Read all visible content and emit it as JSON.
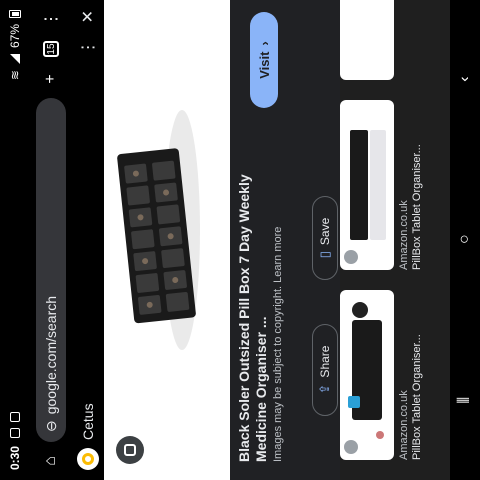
{
  "status_bar": {
    "time": "0:30",
    "battery": "67%"
  },
  "browser": {
    "url": "google.com/search",
    "tab_count": "15"
  },
  "lens": {
    "title": "Cetus"
  },
  "result": {
    "title": "Black Soler Outsized Pill Box 7 Day Weekly Medicine Organiser ...",
    "subtitle": "Images may be subject to copyright. Learn more",
    "visit_label": "Visit",
    "share_label": "Share",
    "save_label": "Save"
  },
  "related": [
    {
      "source": "Amazon.co.uk",
      "title": "PillBox Tablet Organiser..."
    },
    {
      "source": "Amazon.co.uk",
      "title": "PillBox Tablet Organiser..."
    }
  ]
}
